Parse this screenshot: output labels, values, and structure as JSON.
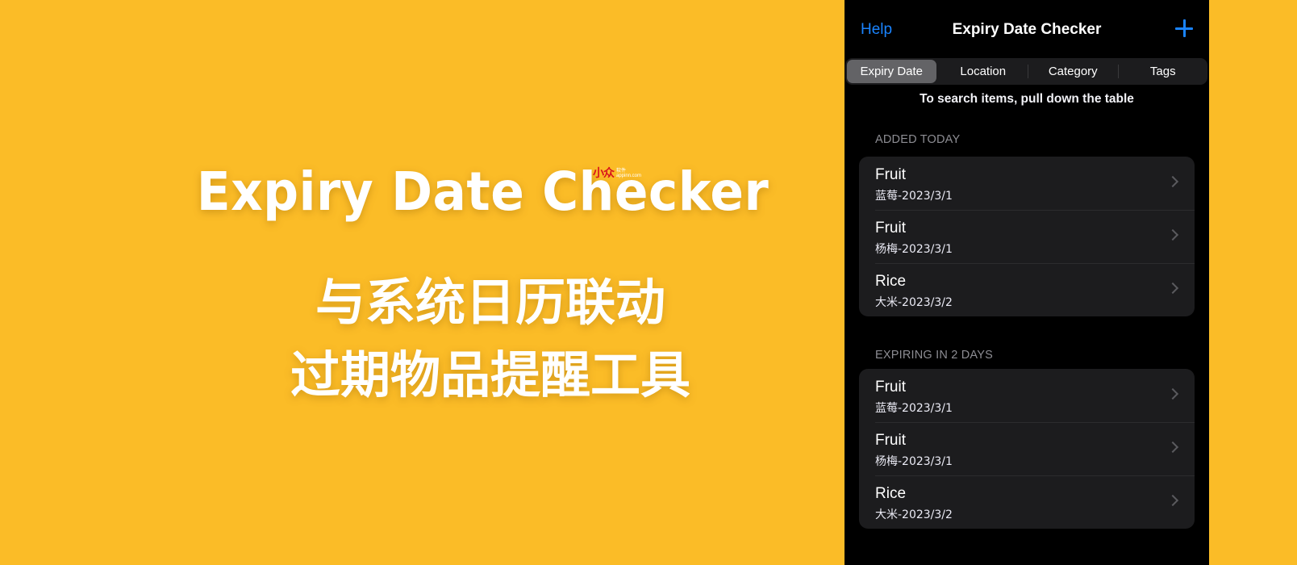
{
  "hero": {
    "title": "Expiry Date Checker",
    "logo_mark": "小众",
    "logo_small_top": "软件",
    "logo_small_bottom": "appinn.com",
    "subtitle_line1": "与系统日历联动",
    "subtitle_line2": "过期物品提醒工具"
  },
  "colors": {
    "background": "#fbbc27",
    "phone_background": "#000000",
    "card_background": "#1c1c1e",
    "accent": "#1a84ff",
    "logo_red": "#d8141c"
  },
  "app": {
    "nav": {
      "left_label": "Help",
      "title": "Expiry Date Checker",
      "add_icon": "plus-icon"
    },
    "segments": [
      {
        "label": "Expiry Date",
        "selected": true
      },
      {
        "label": "Location",
        "selected": false
      },
      {
        "label": "Category",
        "selected": false
      },
      {
        "label": "Tags",
        "selected": false
      }
    ],
    "hint": "To search items, pull down the table",
    "sections": [
      {
        "header": "ADDED TODAY",
        "items": [
          {
            "title": "Fruit",
            "subtitle": "蓝莓-2023/3/1"
          },
          {
            "title": "Fruit",
            "subtitle": "杨梅-2023/3/1"
          },
          {
            "title": "Rice",
            "subtitle": "大米-2023/3/2"
          }
        ]
      },
      {
        "header": "EXPIRING IN 2 DAYS",
        "items": [
          {
            "title": "Fruit",
            "subtitle": "蓝莓-2023/3/1"
          },
          {
            "title": "Fruit",
            "subtitle": "杨梅-2023/3/1"
          },
          {
            "title": "Rice",
            "subtitle": "大米-2023/3/2"
          }
        ]
      }
    ]
  }
}
